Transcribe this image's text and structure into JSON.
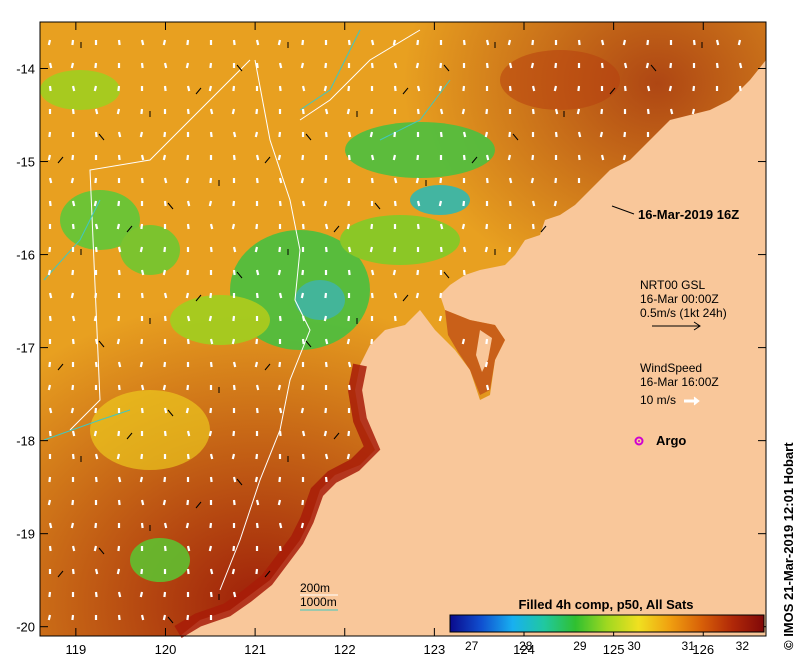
{
  "map": {
    "lon_range": [
      118.6,
      126.7
    ],
    "lat_range": [
      -20.1,
      -13.5
    ],
    "lon_ticks": [
      119,
      120,
      121,
      122,
      123,
      124,
      125,
      126
    ],
    "lat_ticks": [
      -14,
      -15,
      -16,
      -17,
      -18,
      -19,
      -20
    ],
    "lon_tick_labels": [
      "119",
      "120",
      "121",
      "122",
      "123",
      "124",
      "125",
      "126"
    ],
    "lat_tick_labels": [
      "-14",
      "-15",
      "-16",
      "-17",
      "-18",
      "-19",
      "-20"
    ],
    "land_color": "#f9c79a",
    "isobath_200_color": "#ffffff",
    "isobath_1000_color": "#40c8c0"
  },
  "annotations": {
    "timestamp": "16-Mar-2019 16Z",
    "current_source": "NRT00 GSL",
    "current_time": "16-Mar 00:00Z",
    "current_scale": "0.5m/s (1kt 24h)",
    "wind_title": "WindSpeed",
    "wind_time": "16-Mar 16:00Z",
    "wind_scale": "10 m/s",
    "argo_label": "Argo"
  },
  "legend": {
    "isobath_200": "200m",
    "isobath_1000": "1000m"
  },
  "colorbar": {
    "title": "Filled 4h comp, p50, All Sats",
    "ticks": [
      27,
      28,
      29,
      30,
      31,
      32
    ],
    "tick_labels": [
      "27",
      "28",
      "29",
      "30",
      "31",
      "32"
    ],
    "range": [
      26.6,
      32.4
    ],
    "colors": [
      "#0a0a8c",
      "#1050d0",
      "#18b0f0",
      "#20c8a0",
      "#30c030",
      "#a0d820",
      "#f0e020",
      "#f0a010",
      "#d86008",
      "#b02808",
      "#800808"
    ]
  },
  "credit": "© IMOS 21-Mar-2019 12:01 Hobart"
}
